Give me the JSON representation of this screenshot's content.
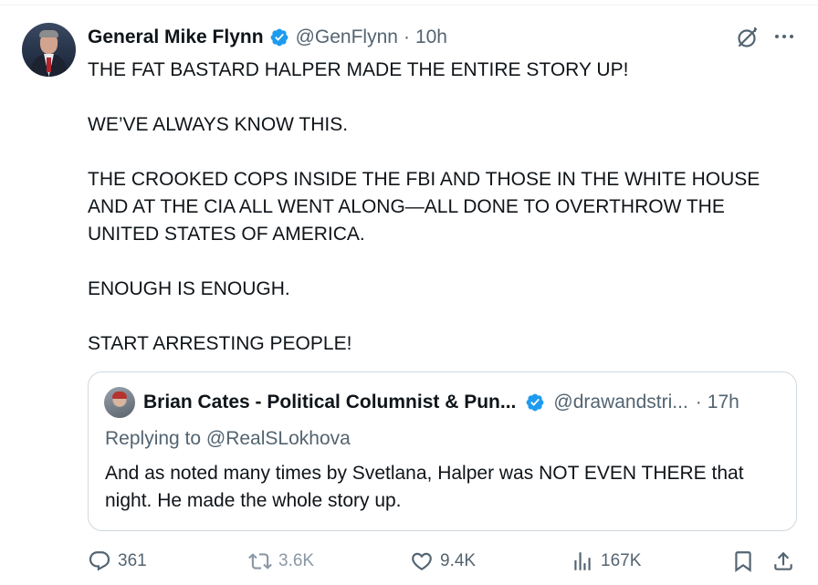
{
  "tweet": {
    "author_name": "General Mike Flynn",
    "handle": "@GenFlynn",
    "separator": "·",
    "time": "10h",
    "paragraphs": [
      "THE FAT BASTARD HALPER MADE THE ENTIRE STORY UP!",
      "WE’VE ALWAYS KNOW THIS.",
      "THE CROOKED COPS INSIDE THE FBI AND THOSE IN THE WHITE HOUSE AND AT THE CIA ALL WENT ALONG—ALL DONE TO OVERTHROW THE UNITED STATES OF AMERICA.",
      "ENOUGH IS ENOUGH.",
      "START ARRESTING PEOPLE!"
    ]
  },
  "quote": {
    "author_name": "Brian Cates - Political Columnist & Pun...",
    "handle": "@drawandstri...",
    "separator": "·",
    "time": "17h",
    "replying_to": "Replying to @RealSLokhova",
    "text": "And as noted many times by Svetlana, Halper was NOT EVEN THERE that night.  He made the whole story up."
  },
  "actions": {
    "replies": "361",
    "reposts": "3.6K",
    "likes": "9.4K",
    "views": "167K"
  },
  "icons": {
    "verified": "verified-badge-icon",
    "grok": "grok-icon",
    "more": "more-icon",
    "reply": "reply-icon",
    "repost": "repost-icon",
    "like": "heart-icon",
    "views": "views-icon",
    "bookmark": "bookmark-icon",
    "share": "share-icon"
  },
  "colors": {
    "verified_blue": "#1d9bf0",
    "secondary_text": "#536471",
    "border": "#cfd9de"
  }
}
